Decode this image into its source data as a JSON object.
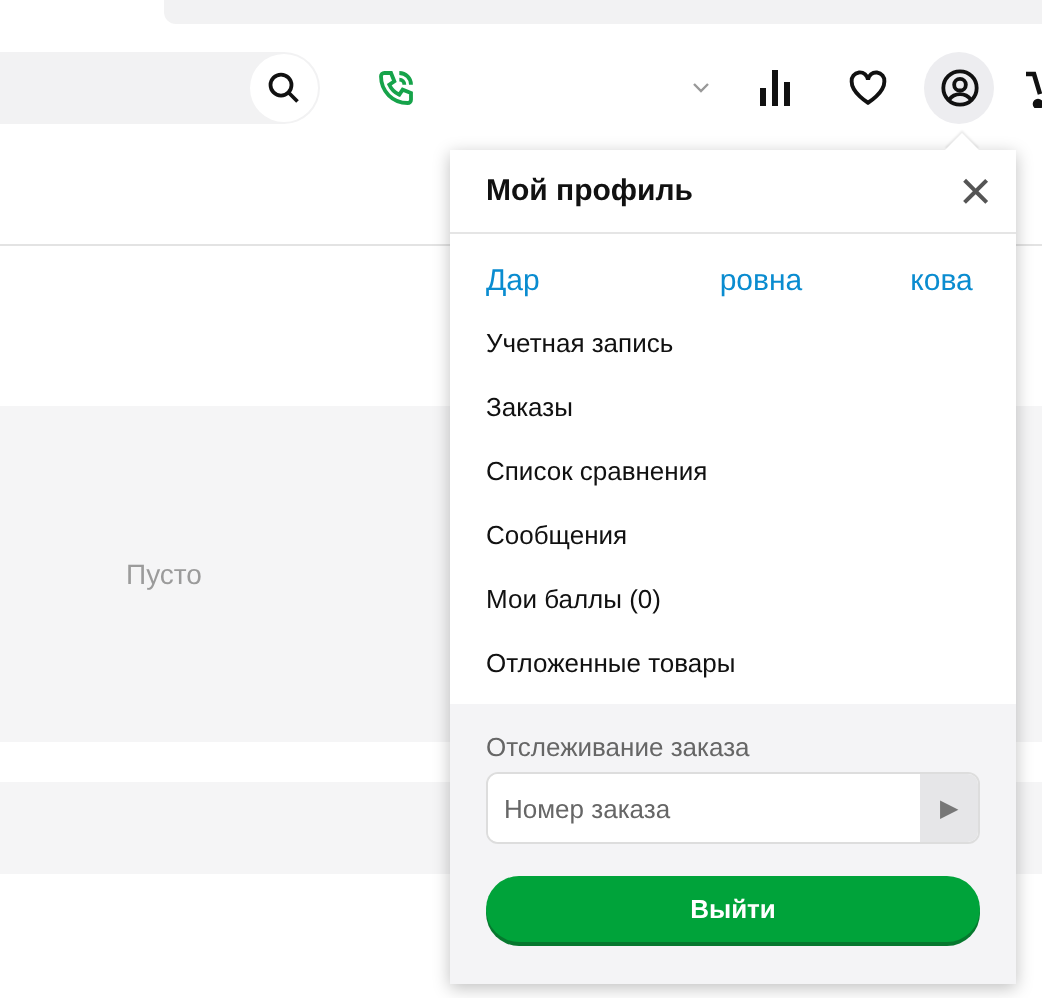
{
  "content": {
    "empty_text": "Пусто"
  },
  "profile_menu": {
    "title": "Мой профиль",
    "close": "×",
    "user_name_parts": [
      "Дар",
      "ровна",
      "кова"
    ],
    "items": [
      "Учетная запись",
      "Заказы",
      "Список сравнения",
      "Сообщения",
      "Мои баллы (0)",
      "Отложенные товары"
    ],
    "tracking": {
      "label": "Отслеживание заказа",
      "placeholder": "Номер заказа",
      "submit": "▶"
    },
    "logout": "Выйти"
  }
}
